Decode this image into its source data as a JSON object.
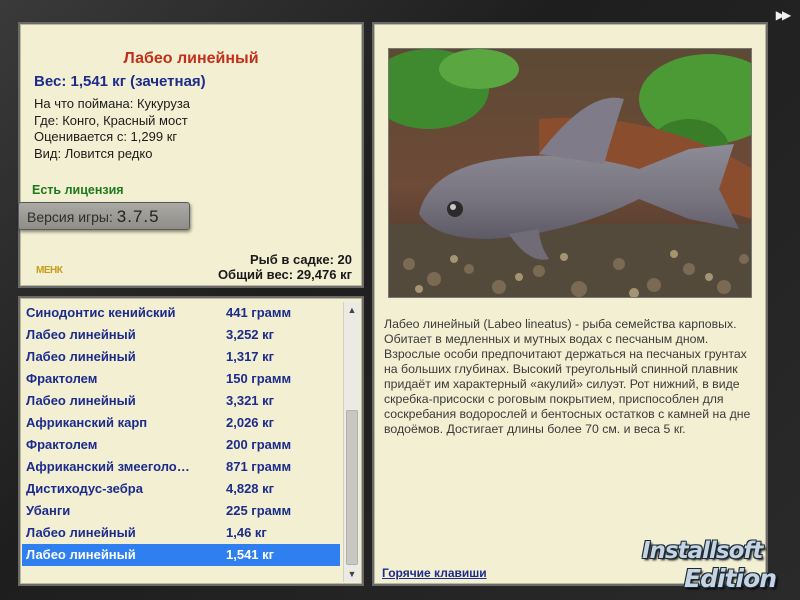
{
  "window": {
    "next_icon": "▶▶"
  },
  "fish_info": {
    "title": "Лабео линейный",
    "weight_line": "Вес: 1,541 кг (зачетная)",
    "caught_on": "На что поймана: Кукуруза",
    "location": "Где: Конго, Красный мост",
    "valued_from": "Оценивается с: 1,299 кг",
    "rarity": "Вид: Ловится редко",
    "license": "Есть лицензия",
    "version_label": "Версия игры:",
    "version_number": "3.7.5",
    "small_logo": "МЕНК",
    "fish_count": "Рыб в садке: 20",
    "total_weight": "Общий вес: 29,476 кг"
  },
  "catch_list": {
    "rows": [
      {
        "name": "Синодонтис кенийский",
        "weight": "441 грамм"
      },
      {
        "name": "Лабео линейный",
        "weight": "3,252 кг"
      },
      {
        "name": "Лабео линейный",
        "weight": "1,317 кг"
      },
      {
        "name": "Фрактолем",
        "weight": "150 грамм"
      },
      {
        "name": "Лабео линейный",
        "weight": "3,321 кг"
      },
      {
        "name": "Африканский карп",
        "weight": "2,026 кг"
      },
      {
        "name": "Фрактолем",
        "weight": "200 грамм"
      },
      {
        "name": "Африканский змееголо…",
        "weight": "871 грамм"
      },
      {
        "name": "Дистиходус-зебра",
        "weight": "4,828 кг"
      },
      {
        "name": "Убанги",
        "weight": "225 грамм"
      },
      {
        "name": "Лабео линейный",
        "weight": "1,46 кг"
      },
      {
        "name": "Лабео линейный",
        "weight": "1,541 кг"
      }
    ],
    "selected_index": 11,
    "scroll_up_icon": "▲",
    "scroll_down_icon": "▼"
  },
  "details": {
    "description": "Лабео линейный (Labeo lineatus) - рыба семейства карповых. Обитает в медленных и мутных водах с песчаным дном. Взрослые особи предпочитают держаться на песчаных грунтах на больших глубинах. Высокий треугольный спинной плавник придаёт им характерный «акулий» силуэт. Рот нижний, в виде скребка-присоски с роговым покрытием, приспособлен для соскребания водорослей и бентосных остатков с камней на дне водоёмов. Достигает длины более 70 см. и веса 5 кг.",
    "hotkeys_link": "Горячие клавиши"
  },
  "brand": {
    "line1": "Installsoft",
    "line2": "Edition"
  }
}
